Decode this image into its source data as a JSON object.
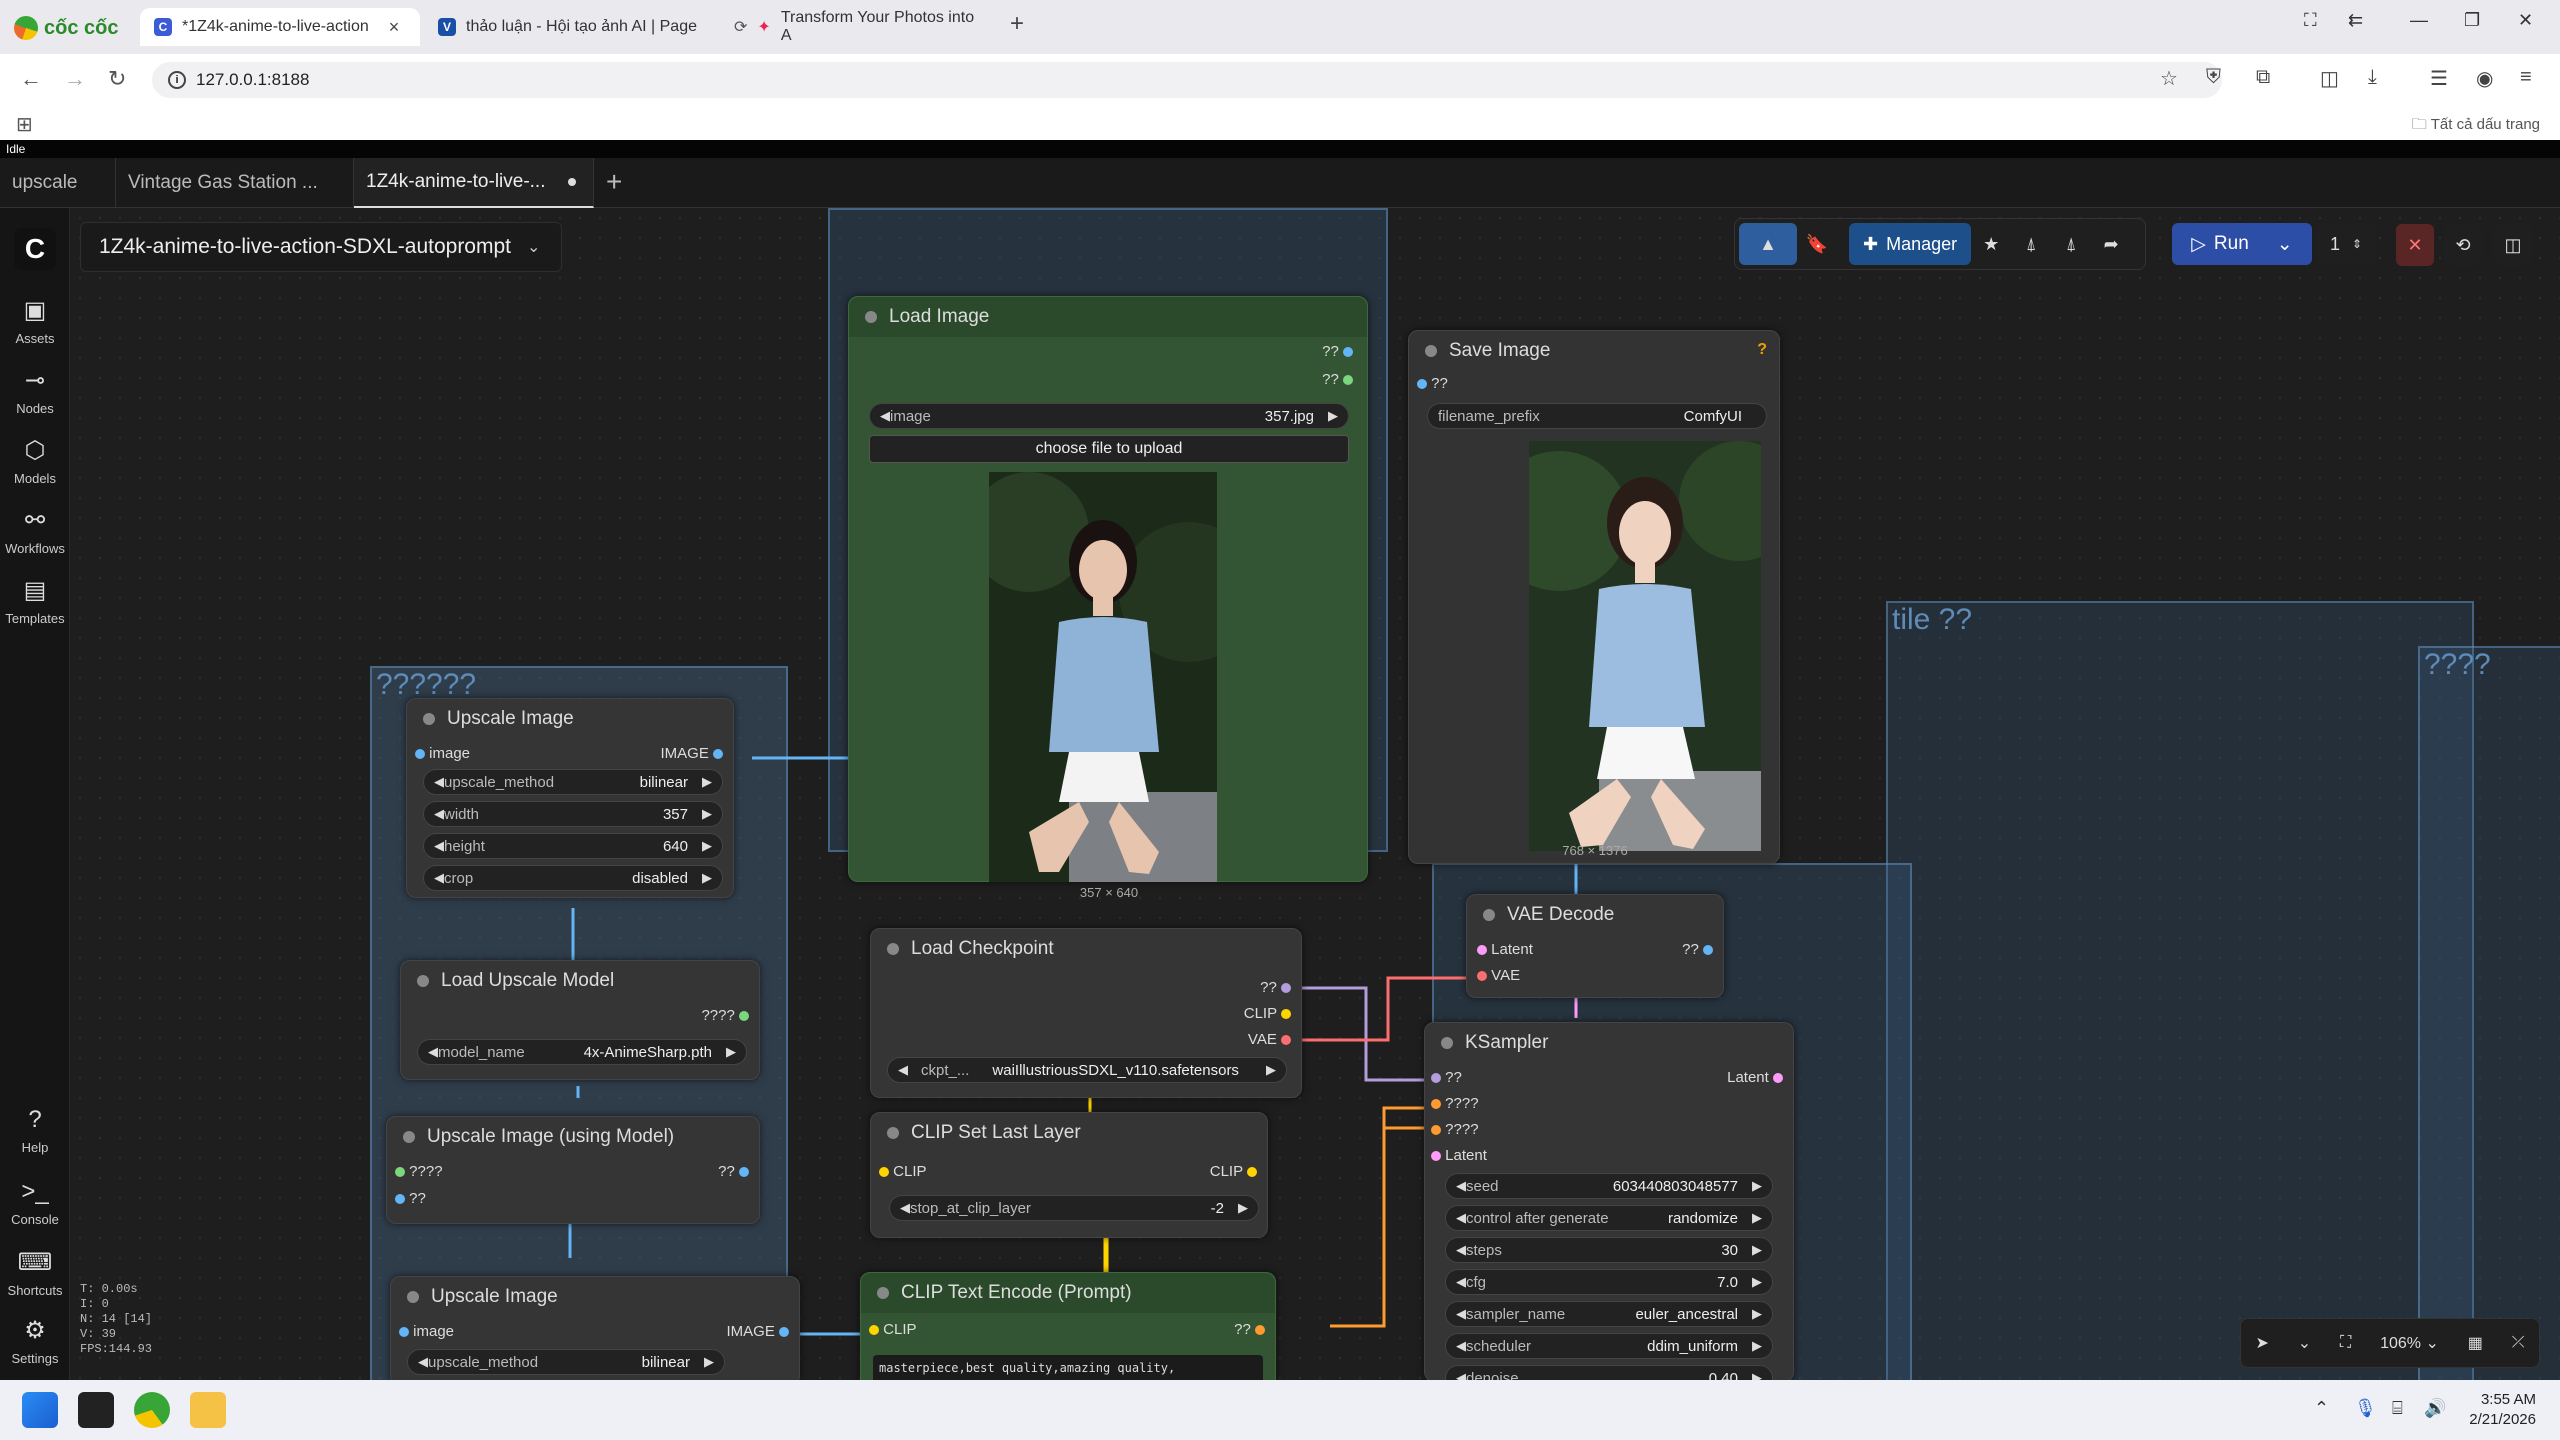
{
  "browser": {
    "brand": "cốc cốc",
    "tabs": [
      {
        "label": "*1Z4k-anime-to-live-action",
        "active": true
      },
      {
        "label": "thảo luận - Hội tạo ảnh AI | Page",
        "active": false
      },
      {
        "label": "Transform Your Photos into A",
        "active": false
      }
    ],
    "url": "127.0.0.1:8188",
    "all_bookmarks": "Tất cả dấu trang",
    "status": "Idle"
  },
  "comfy": {
    "tabs": [
      {
        "label": "upscale"
      },
      {
        "label": "Vintage Gas Station ..."
      },
      {
        "label": "1Z4k-anime-to-live-..."
      }
    ],
    "workflow_title": "1Z4k-anime-to-live-action-SDXL-autoprompt",
    "sidebar": [
      {
        "label": "Assets",
        "icon": "image-icon"
      },
      {
        "label": "Nodes",
        "icon": "nodes-icon"
      },
      {
        "label": "Models",
        "icon": "cube-icon"
      },
      {
        "label": "Workflows",
        "icon": "workflow-icon"
      },
      {
        "label": "Templates",
        "icon": "template-icon"
      }
    ],
    "sidebar_bottom": [
      {
        "label": "Help",
        "icon": "help-icon"
      },
      {
        "label": "Console",
        "icon": "console-icon"
      },
      {
        "label": "Shortcuts",
        "icon": "keyboard-icon"
      },
      {
        "label": "Settings",
        "icon": "gear-icon"
      }
    ],
    "stats": [
      "T: 0.00s",
      "I: 0",
      "N: 14 [14]",
      "V: 39",
      "FPS:144.93"
    ],
    "toolbar": {
      "manager": "Manager",
      "run": "Run",
      "queue_count": "1"
    },
    "zoom": "106%",
    "groups": {
      "g1": "??????",
      "g2": "tile ??",
      "g3": "????"
    },
    "nodes": {
      "load_image": {
        "title": "Load Image",
        "out1": "??",
        "out2": "??",
        "image_label": "image",
        "image_value": "357.jpg",
        "upload": "choose file to upload",
        "size": "357 × 640"
      },
      "save_image": {
        "title": "Save Image",
        "help": "?",
        "in1": "??",
        "prefix_label": "filename_prefix",
        "prefix_value": "ComfyUI",
        "size": "768 × 1376"
      },
      "upscale_image_1": {
        "title": "Upscale Image",
        "in": "image",
        "out": "IMAGE",
        "widgets": [
          {
            "label": "upscale_method",
            "value": "bilinear"
          },
          {
            "label": "width",
            "value": "357"
          },
          {
            "label": "height",
            "value": "640"
          },
          {
            "label": "crop",
            "value": "disabled"
          }
        ]
      },
      "load_upscale_model": {
        "title": "Load Upscale Model",
        "out": "????",
        "model_label": "model_name",
        "model_value": "4x-AnimeSharp.pth"
      },
      "upscale_using_model": {
        "title": "Upscale Image (using Model)",
        "in1": "????",
        "in2": "??",
        "out": "??"
      },
      "upscale_image_2": {
        "title": "Upscale Image",
        "in": "image",
        "out": "IMAGE",
        "method_label": "upscale_method",
        "method_value": "bilinear"
      },
      "load_checkpoint": {
        "title": "Load Checkpoint",
        "out1": "??",
        "out2": "CLIP",
        "out3": "VAE",
        "ckpt_label": "ckpt_...",
        "ckpt_value": "waiIllustriousSDXL_v110.safetensors"
      },
      "clip_set_last": {
        "title": "CLIP Set Last Layer",
        "in": "CLIP",
        "out": "CLIP",
        "w_label": "stop_at_clip_layer",
        "w_value": "-2"
      },
      "clip_text_encode": {
        "title": "CLIP Text Encode (Prompt)",
        "in": "CLIP",
        "out": "??",
        "text": "masterpiece,best quality,amazing quality,"
      },
      "vae_decode": {
        "title": "VAE Decode",
        "in1": "Latent",
        "in2": "VAE",
        "out": "??"
      },
      "ksampler": {
        "title": "KSampler",
        "in1": "??",
        "in2": "????",
        "in3": "????",
        "in4": "Latent",
        "out": "Latent",
        "widgets": [
          {
            "label": "seed",
            "value": "603440803048577"
          },
          {
            "label": "control after generate",
            "value": "randomize"
          },
          {
            "label": "steps",
            "value": "30"
          },
          {
            "label": "cfg",
            "value": "7.0"
          },
          {
            "label": "sampler_name",
            "value": "euler_ancestral"
          },
          {
            "label": "scheduler",
            "value": "ddim_uniform"
          },
          {
            "label": "denoise",
            "value": "0.40"
          }
        ]
      }
    }
  },
  "taskbar": {
    "time": "3:55 AM",
    "date": "2/21/2026"
  },
  "colors": {
    "image": "#64b5f6",
    "clip": "#ffd500",
    "vae": "#ff6e6e",
    "latent": "#ff9cf9",
    "model": "#b39ddb",
    "upscale_model": "#7cd67c",
    "group": "#4a7099"
  }
}
